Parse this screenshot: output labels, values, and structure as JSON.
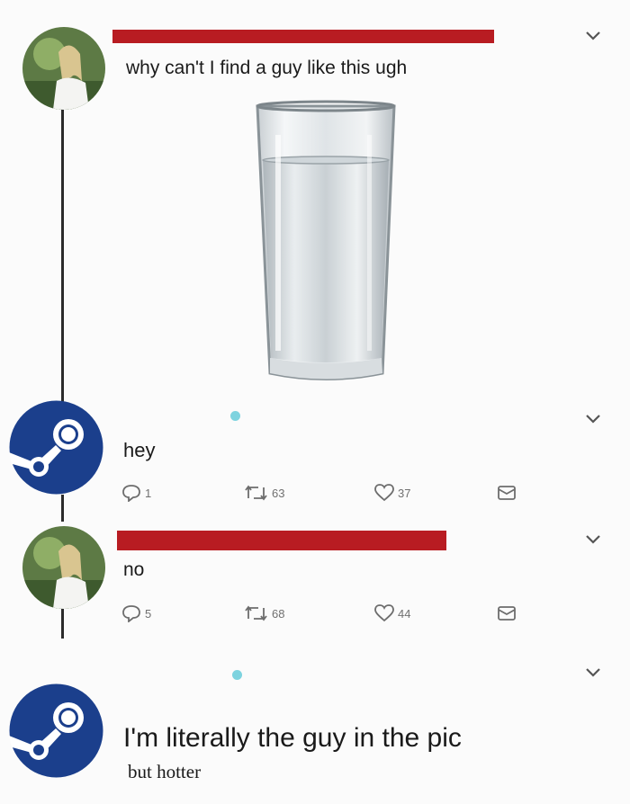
{
  "tweets": [
    {
      "author": "woman-profile",
      "text": "why can't I find a guy like this ugh",
      "media": "glass-of-water-image"
    },
    {
      "author": "steam",
      "text": "hey",
      "actions": {
        "replies": "1",
        "retweets": "63",
        "likes": "37"
      }
    },
    {
      "author": "woman-profile",
      "text": "no",
      "actions": {
        "replies": "5",
        "retweets": "68",
        "likes": "44"
      }
    },
    {
      "author": "steam",
      "text": "I'm literally the guy in the pic",
      "subtext": "but hotter"
    }
  ],
  "icons": {
    "reply": "reply-icon",
    "retweet": "retweet-icon",
    "like": "heart-icon",
    "dm": "mail-icon",
    "more": "chevron-down-icon"
  },
  "colors": {
    "redaction": "#b81c22",
    "steam_blue": "#1b3f8c",
    "online_dot": "#7dd3df"
  }
}
